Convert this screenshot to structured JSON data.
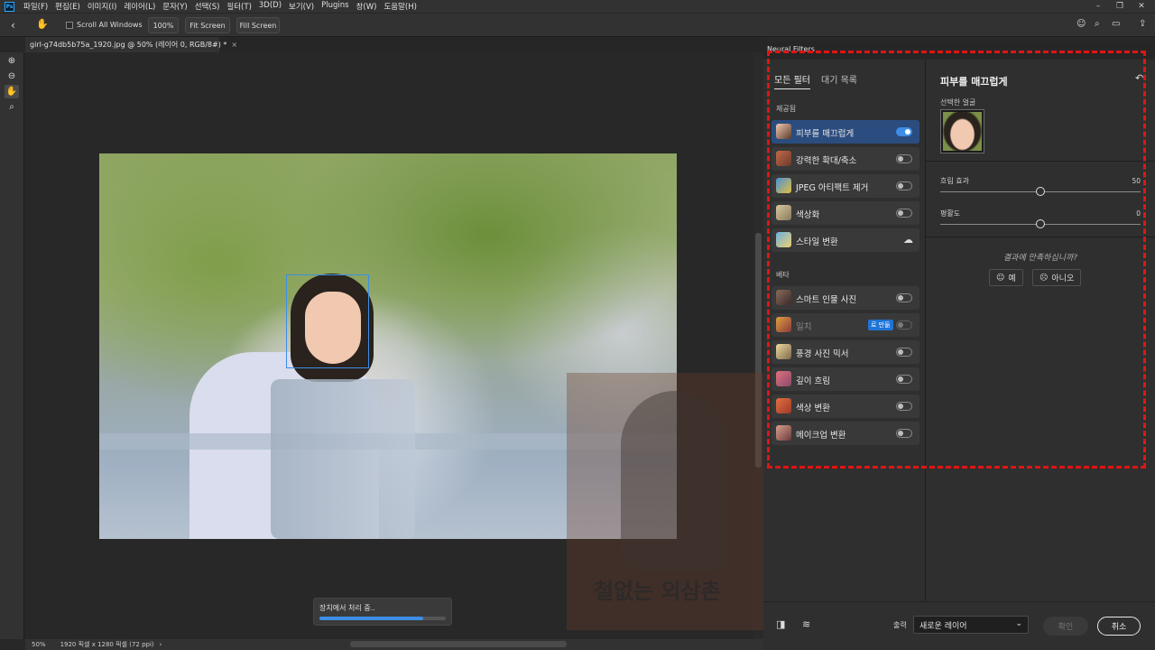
{
  "menubar": {
    "logo": "Ps",
    "items": [
      "파일(F)",
      "편집(E)",
      "이미지(I)",
      "레이어(L)",
      "문자(Y)",
      "선택(S)",
      "필터(T)",
      "3D(D)",
      "보기(V)",
      "Plugins",
      "창(W)",
      "도움말(H)"
    ]
  },
  "options": {
    "scroll_all_windows": "Scroll All Windows",
    "zoom_100": "100%",
    "fit_screen": "Fit Screen",
    "fill_screen": "Fill Screen"
  },
  "document": {
    "tab_title": "girl-g74db5b75a_1920.jpg @ 50% (레이어 0, RGB/8#) *",
    "close": "×"
  },
  "status": {
    "zoom": "50%",
    "dimensions": "1920 픽셀 x 1280 픽셀 (72 ppi)",
    "arrow": "›"
  },
  "progress": {
    "label": "장치에서 처리 중..",
    "value": 0.82
  },
  "watermark": {
    "text": "철없는 외삼촌"
  },
  "neural_filters": {
    "panel_title": "Neural Filters",
    "tabs": [
      "모든 필터",
      "대기 목록"
    ],
    "sections": {
      "featured": "제공됨",
      "beta": "베타"
    },
    "featured_filters": [
      {
        "name": "피부를 매끄럽게",
        "state": "on"
      },
      {
        "name": "강력한 확대/축소",
        "state": "off"
      },
      {
        "name": "JPEG 아티팩트 제거",
        "state": "off"
      },
      {
        "name": "색상화",
        "state": "off"
      },
      {
        "name": "스타일 변환",
        "state": "cloud"
      }
    ],
    "beta_filters": [
      {
        "name": "스마트 인물 사진",
        "state": "off"
      },
      {
        "name": "일치",
        "state": "off",
        "badge": "로 만듦"
      },
      {
        "name": "풍경 사진 믹서",
        "state": "off"
      },
      {
        "name": "깊이 흐림",
        "state": "off"
      },
      {
        "name": "색상 변환",
        "state": "off"
      },
      {
        "name": "메이크업 변환",
        "state": "off"
      }
    ]
  },
  "settings": {
    "title": "피부를 매끄럽게",
    "selected_face": "선택한 얼굴",
    "sliders": [
      {
        "label": "흐림 효과",
        "value": 50,
        "max": 100
      },
      {
        "label": "평활도",
        "value": 0,
        "min": -50,
        "max": 50
      }
    ],
    "question": "결과에 만족하십니까?",
    "yes": "예",
    "no": "아니오"
  },
  "footer": {
    "output_label": "출력",
    "output_value": "새로운 레이어",
    "ok": "확인",
    "cancel": "취소"
  },
  "colors": {
    "accent": "#3d8ee6",
    "highlight": "#e11414"
  }
}
